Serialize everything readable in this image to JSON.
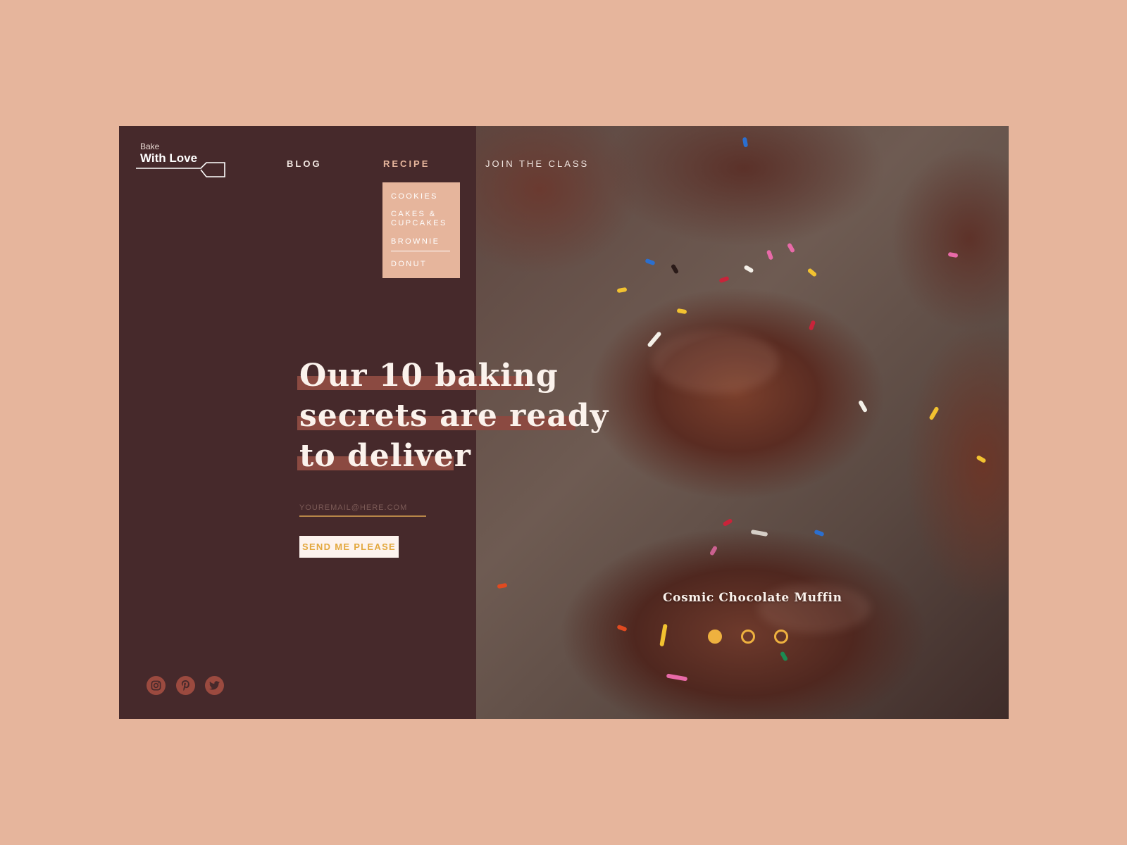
{
  "brand": {
    "line1": "Bake",
    "line2": "With Love"
  },
  "nav": {
    "items": [
      {
        "label": "BLOG"
      },
      {
        "label": "RECIPE",
        "active": true
      },
      {
        "label": "JOIN THE CLASS"
      }
    ],
    "recipe_dropdown": [
      {
        "label": "COOKIES"
      },
      {
        "label": "CAKES & CUPCAKES"
      },
      {
        "label": "BROWNIE",
        "selected": true
      },
      {
        "label": "DONUT"
      }
    ]
  },
  "hero": {
    "headline_lines": [
      "Our 10 baking",
      "secrets are ready",
      "to deliver"
    ],
    "email_placeholder": "YOUREMAIL@HERE.COM",
    "email_value": "",
    "cta_label": "SEND ME PLEASE",
    "caption": "Cosmic Chocolate Muffin",
    "slides": {
      "count": 3,
      "active_index": 0
    }
  },
  "social": [
    {
      "icon": "instagram-icon"
    },
    {
      "icon": "pinterest-icon"
    },
    {
      "icon": "twitter-icon"
    }
  ],
  "colors": {
    "page_background": "#e6b59c",
    "panel_background": "#46292b",
    "accent_peach": "#e6b59c",
    "accent_gold": "#eeb13f",
    "highlight_bar": "#8b4a41",
    "social_icon_bg": "#9b4a3f"
  }
}
